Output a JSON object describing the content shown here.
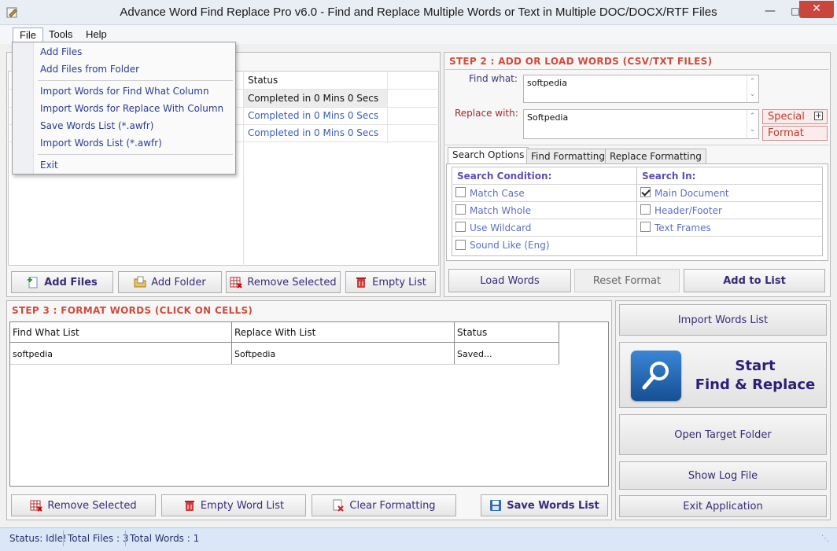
{
  "window": {
    "title": "Advance Word Find Replace Pro v6.0 - Find and Replace Multiple Words or Text in Multiple DOC/DOCX/RTF Files"
  },
  "menubar": {
    "items": [
      "File",
      "Tools",
      "Help"
    ]
  },
  "file_menu": {
    "items": [
      "Add Files",
      "Add Files from Folder",
      "Import Words for Find What Column",
      "Import Words for Replace With Column",
      "Save Words List (*.awfr)",
      "Import Words List (*.awfr)",
      "Exit"
    ]
  },
  "files_panel": {
    "status_header": "Status",
    "rows": [
      "Completed in 0 Mins 0 Secs",
      "Completed in 0 Mins 0 Secs",
      "Completed in 0 Mins 0 Secs"
    ],
    "buttons": {
      "add_files": "Add Files",
      "add_folder": "Add Folder",
      "remove_selected": "Remove Selected",
      "empty_list": "Empty List"
    }
  },
  "step2": {
    "title": "STEP 2 : ADD OR LOAD WORDS (CSV/TXT FILES)",
    "find_label": "Find what:",
    "find_value": "softpedia",
    "replace_label": "Replace with:",
    "replace_value": "Softpedia",
    "special_label": "Special",
    "format_label": "Format",
    "tabs": [
      "Search Options",
      "Find Formatting",
      "Replace Formatting"
    ],
    "search_condition": {
      "heading": "Search Condition:",
      "options": [
        {
          "label": "Match Case",
          "checked": false
        },
        {
          "label": "Match Whole",
          "checked": false
        },
        {
          "label": "Use Wildcard",
          "checked": false
        },
        {
          "label": "Sound Like (Eng)",
          "checked": false
        }
      ]
    },
    "search_in": {
      "heading": "Search In:",
      "options": [
        {
          "label": "Main Document",
          "checked": true
        },
        {
          "label": "Header/Footer",
          "checked": false
        },
        {
          "label": "Text Frames",
          "checked": false
        }
      ]
    },
    "buttons": {
      "load_words": "Load Words",
      "reset_format": "Reset Format",
      "add_to_list": "Add to List"
    }
  },
  "step3": {
    "title": "STEP 3 : FORMAT WORDS (CLICK ON CELLS)",
    "columns": [
      "Find What List",
      "Replace With List",
      "Status"
    ],
    "rows": [
      [
        "softpedia",
        "Softpedia",
        "Saved..."
      ]
    ],
    "buttons": {
      "remove_selected": "Remove Selected",
      "empty_word_list": "Empty Word List",
      "clear_formatting": "Clear Formatting",
      "save_words_list": "Save Words List"
    }
  },
  "side_buttons": {
    "import_words_list": "Import Words List",
    "start_line1": "Start",
    "start_line2": "Find & Replace",
    "open_target_folder": "Open Target Folder",
    "show_log_file": "Show Log File",
    "exit_application": "Exit Application"
  },
  "statusbar": {
    "status": "Status:  Idle!",
    "total_files": "Total Files : 3",
    "total_words": "Total Words : 1"
  },
  "colors": {
    "accent_red": "#d24b3c",
    "label_purple": "#3a2a78",
    "link_blue": "#2a3c8f",
    "start_button_blue": "#1d5fa8"
  }
}
